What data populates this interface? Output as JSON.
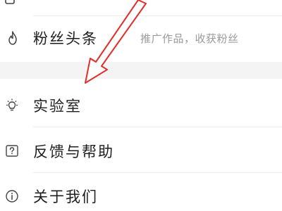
{
  "menu": {
    "items": [
      {
        "label": "",
        "icon": "partial-icon"
      },
      {
        "label": "粉丝头条",
        "hint": "推广作品，收获粉丝",
        "icon": "flame-icon"
      },
      {
        "label": "实验室",
        "icon": "lightbulb-icon"
      },
      {
        "label": "反馈与帮助",
        "icon": "question-square-icon"
      },
      {
        "label": "关于我们",
        "icon": "info-circle-icon"
      }
    ]
  },
  "colors": {
    "annotation_arrow": "#e0302c",
    "label": "#1e1e1e",
    "hint": "#9a9a9a",
    "section_gap": "#f4f4f4"
  }
}
